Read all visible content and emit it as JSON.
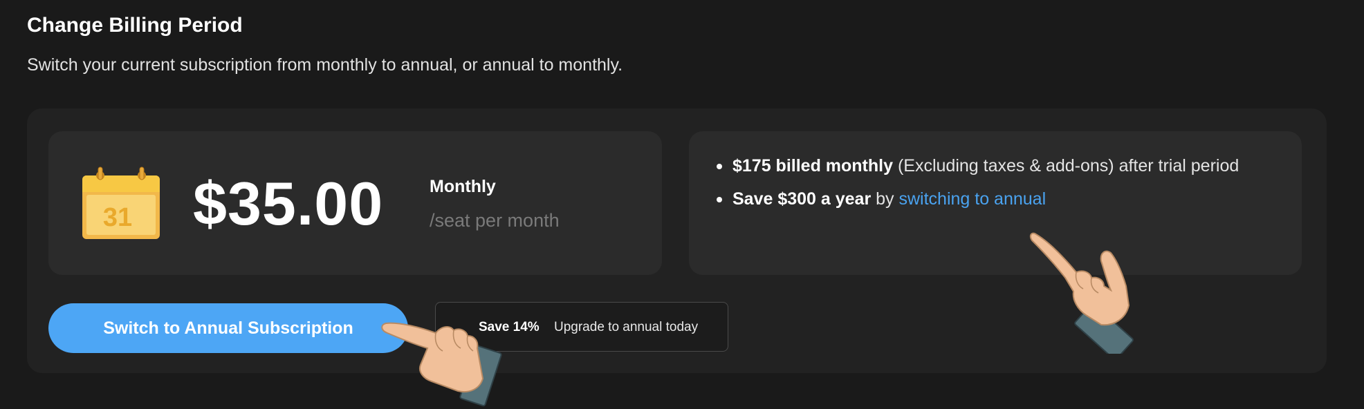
{
  "header": {
    "title": "Change Billing Period",
    "subtitle": "Switch your current subscription from monthly to annual, or annual to monthly."
  },
  "plan": {
    "calendar_day": "31",
    "price": "$35.00",
    "period": "Monthly",
    "per_seat": "/seat per month"
  },
  "details": {
    "line1_bold": "$175 billed monthly",
    "line1_rest": " (Excluding taxes & add-ons) after trial period",
    "line2_bold": "Save $300 a year",
    "line2_mid": " by ",
    "line2_link": "switching to annual"
  },
  "actions": {
    "switch_button": "Switch to Annual Subscription",
    "promo_save": "Save 14%",
    "promo_text": "Upgrade to annual today"
  },
  "icons": {
    "calendar": "calendar-icon",
    "pointer": "pointing-hand-icon"
  },
  "colors": {
    "background": "#1a1a1a",
    "card": "#2b2b2b",
    "accent": "#4da6f5",
    "link": "#4aa3f0",
    "calendar": "#f7c844"
  }
}
